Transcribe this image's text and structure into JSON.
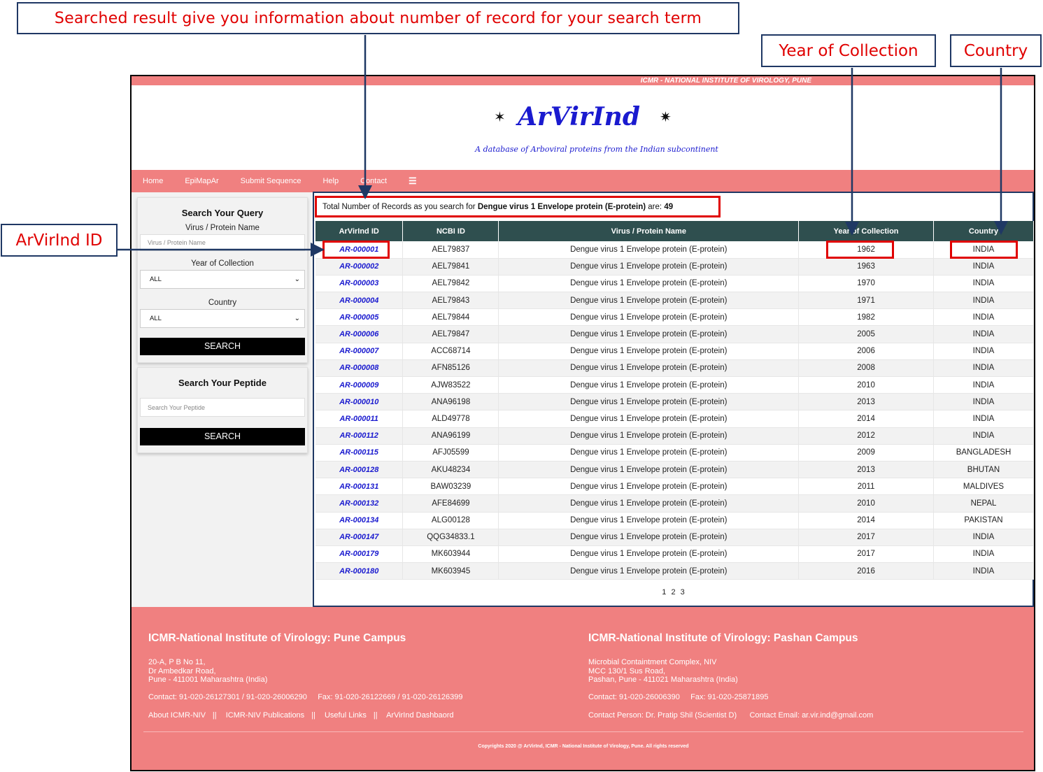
{
  "annotations": {
    "top": "Searched result give you information about number of  record for your search term",
    "year": "Year of Collection",
    "country": "Country",
    "id": "ArVirInd ID"
  },
  "header": {
    "strip": "ICMR - NATIONAL INSTITUTE OF VIROLOGY, PUNE",
    "logo": "ArVirInd",
    "tagline": "A database of Arboviral proteins from the Indian subcontinent"
  },
  "nav": [
    "Home",
    "EpiMapAr",
    "Submit Sequence",
    "Help",
    "Contact"
  ],
  "query_panel": {
    "title": "Search Your Query",
    "virus_label": "Virus / Protein Name",
    "virus_placeholder": "Virus / Protein Name",
    "year_label": "Year of Collection",
    "year_value": "ALL",
    "country_label": "Country",
    "country_value": "ALL",
    "search": "SEARCH"
  },
  "peptide_panel": {
    "title": "Search Your Peptide",
    "placeholder": "Search Your Peptide",
    "search": "SEARCH"
  },
  "results": {
    "prefix": "Total Number of Records as you search for",
    "term": "Dengue virus 1 Envelope protein (E-protein)",
    "are": "are:",
    "count": "49",
    "columns": [
      "ArVirInd ID",
      "NCBI ID",
      "Virus / Protein Name",
      "Year of Collection",
      "Country"
    ],
    "rows": [
      [
        "AR-000001",
        "AEL79837",
        "Dengue virus 1 Envelope protein (E-protein)",
        "1962",
        "INDIA"
      ],
      [
        "AR-000002",
        "AEL79841",
        "Dengue virus 1 Envelope protein (E-protein)",
        "1963",
        "INDIA"
      ],
      [
        "AR-000003",
        "AEL79842",
        "Dengue virus 1 Envelope protein (E-protein)",
        "1970",
        "INDIA"
      ],
      [
        "AR-000004",
        "AEL79843",
        "Dengue virus 1 Envelope protein (E-protein)",
        "1971",
        "INDIA"
      ],
      [
        "AR-000005",
        "AEL79844",
        "Dengue virus 1 Envelope protein (E-protein)",
        "1982",
        "INDIA"
      ],
      [
        "AR-000006",
        "AEL79847",
        "Dengue virus 1 Envelope protein (E-protein)",
        "2005",
        "INDIA"
      ],
      [
        "AR-000007",
        "ACC68714",
        "Dengue virus 1 Envelope protein (E-protein)",
        "2006",
        "INDIA"
      ],
      [
        "AR-000008",
        "AFN85126",
        "Dengue virus 1 Envelope protein (E-protein)",
        "2008",
        "INDIA"
      ],
      [
        "AR-000009",
        "AJW83522",
        "Dengue virus 1 Envelope protein (E-protein)",
        "2010",
        "INDIA"
      ],
      [
        "AR-000010",
        "ANA96198",
        "Dengue virus 1 Envelope protein (E-protein)",
        "2013",
        "INDIA"
      ],
      [
        "AR-000011",
        "ALD49778",
        "Dengue virus 1 Envelope protein (E-protein)",
        "2014",
        "INDIA"
      ],
      [
        "AR-000112",
        "ANA96199",
        "Dengue virus 1 Envelope protein (E-protein)",
        "2012",
        "INDIA"
      ],
      [
        "AR-000115",
        "AFJ05599",
        "Dengue virus 1 Envelope protein (E-protein)",
        "2009",
        "BANGLADESH"
      ],
      [
        "AR-000128",
        "AKU48234",
        "Dengue virus 1 Envelope protein (E-protein)",
        "2013",
        "BHUTAN"
      ],
      [
        "AR-000131",
        "BAW03239",
        "Dengue virus 1 Envelope protein (E-protein)",
        "2011",
        "MALDIVES"
      ],
      [
        "AR-000132",
        "AFE84699",
        "Dengue virus 1 Envelope protein (E-protein)",
        "2010",
        "NEPAL"
      ],
      [
        "AR-000134",
        "ALG00128",
        "Dengue virus 1 Envelope protein (E-protein)",
        "2014",
        "PAKISTAN"
      ],
      [
        "AR-000147",
        "QQG34833.1",
        "Dengue virus 1 Envelope protein (E-protein)",
        "2017",
        "INDIA"
      ],
      [
        "AR-000179",
        "MK603944",
        "Dengue virus 1 Envelope protein (E-protein)",
        "2017",
        "INDIA"
      ],
      [
        "AR-000180",
        "MK603945",
        "Dengue virus 1 Envelope protein (E-protein)",
        "2016",
        "INDIA"
      ]
    ],
    "pages": [
      "1",
      "2",
      "3"
    ]
  },
  "footer": {
    "pune": {
      "title": "ICMR-National Institute of Virology: Pune Campus",
      "addr1": "20-A, P B No 11,",
      "addr2": "Dr Ambedkar Road,",
      "addr3": "Pune - 411001 Maharashtra (India)",
      "contact": "Contact: 91-020-26127301 / 91-020-26006290",
      "fax": "Fax: 91-020-26122669 / 91-020-26126399",
      "links": [
        "About ICMR-NIV",
        "ICMR-NIV Publications",
        "Useful Links",
        "ArVirInd Dashbaord"
      ]
    },
    "pashan": {
      "title": "ICMR-National Institute of Virology: Pashan Campus",
      "addr1": "Microbial Containtment Complex, NIV",
      "addr2": "MCC 130/1 Sus Road,",
      "addr3": "Pashan, Pune - 411021 Maharashtra (India)",
      "contact": "Contact: 91-020-26006390",
      "fax": "Fax: 91-020-25871895",
      "person": "Contact Person: Dr. Pratip Shil (Scientist D)",
      "email": "Contact Email: ar.vir.ind@gmail.com"
    },
    "copyright": "Copyrights 2020 @ ArVirInd, ICMR - National Institute of Virology, Pune. All rights reserved"
  },
  "colors": {
    "accent": "#f08080",
    "table_header": "#2f4f4f",
    "annotation_text": "#e00000",
    "annotation_border": "#1f3864",
    "link": "#1a1acf"
  }
}
